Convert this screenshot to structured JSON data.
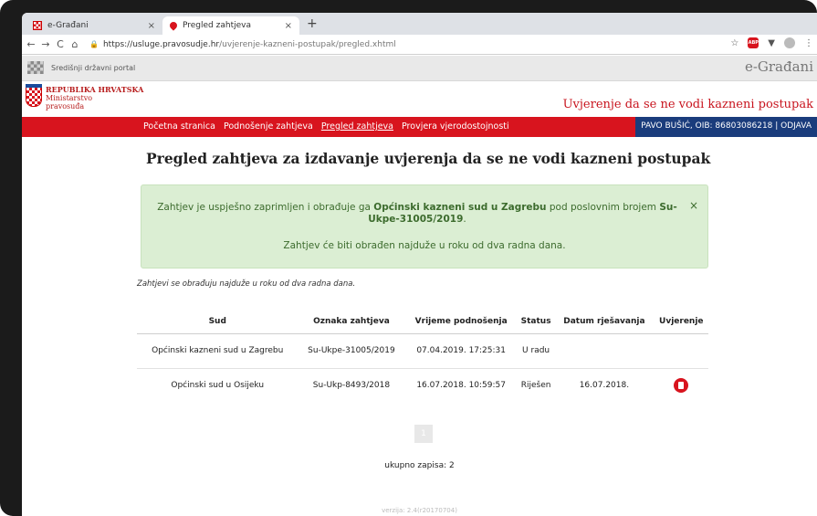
{
  "browser": {
    "tabs": [
      {
        "title": "e-Građani",
        "close": "×"
      },
      {
        "title": "Pregled zahtjeva",
        "close": "×"
      }
    ],
    "new_tab": "+",
    "nav": {
      "back": "←",
      "forward": "→",
      "reload": "C",
      "home": "⌂"
    },
    "url_host": "https://usluge.pravosudje.hr",
    "url_path": "/uvjerenje-kazneni-postupak/pregled.xhtml",
    "right_icons": {
      "bookmark": "☆",
      "abp": "ABP",
      "ext": "▼",
      "menu": "⋮"
    }
  },
  "portal": {
    "label": "Središnji državni portal",
    "brand": "e-Građani"
  },
  "ministry": {
    "line1": "REPUBLIKA HRVATSKA",
    "line2": "Ministarstvo",
    "line3": "pravosuđa",
    "service_title": "Uvjerenje da se ne vodi kazneni postupak"
  },
  "nav": {
    "links": [
      "Početna stranica",
      "Podnošenje zahtjeva",
      "Pregled zahtjeva",
      "Provjera vjerodostojnosti"
    ],
    "user": "PAVO BUŠIĆ, OIB: 86803086218 | ODJAVA"
  },
  "page": {
    "title": "Pregled zahtjeva za izdavanje uvjerenja da se ne vodi kazneni postupak",
    "alert": {
      "prefix": "Zahtjev je uspješno zaprimljen i obrađuje ga ",
      "court": "Općinski kazneni sud u Zagrebu",
      "middle": " pod poslovnim brojem ",
      "number": "Su-Ukpe-31005/2019",
      "suffix": ".",
      "line2": "Zahtjev će biti obrađen najduže u roku od dva radna dana.",
      "close": "×"
    },
    "note": "Zahtjevi se obrađuju najduže u roku od dva radna dana.",
    "table": {
      "headers": [
        "Sud",
        "Oznaka zahtjeva",
        "Vrijeme podnošenja",
        "Status",
        "Datum rješavanja",
        "Uvjerenje"
      ],
      "rows": [
        [
          "Općinski kazneni sud u Zagrebu",
          "Su-Ukpe-31005/2019",
          "07.04.2019. 17:25:31",
          "U radu",
          ""
        ],
        [
          "Općinski sud u Osijeku",
          "Su-Ukp-8493/2018",
          "16.07.2018. 10:59:57",
          "Riješen",
          "16.07.2018."
        ]
      ]
    },
    "pager": "1",
    "total": "ukupno zapisa: 2",
    "version": "verzija: 2.4(r20170704)"
  },
  "colors": {
    "accent_red": "#d8141e",
    "user_blue": "#1a3c7c",
    "alert_bg": "#dbeed3"
  },
  "icons": {
    "download": "pdf-download-icon"
  }
}
